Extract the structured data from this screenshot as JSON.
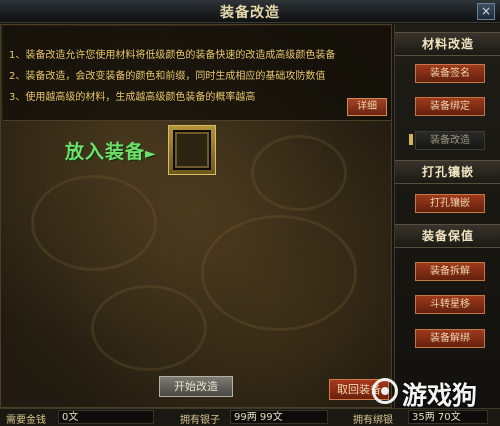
{
  "window": {
    "title": "装备改造",
    "close_glyph": "×"
  },
  "description": {
    "lines": [
      "1、装备改造允许您使用材料将低级颜色的装备快速的改造成高级颜色装备",
      "2、装备改造，会改变装备的颜色和前缀，同时生成相应的基础攻防数值",
      "3、使用越高级的材料，生成越高级颜色装备的概率越高"
    ],
    "detail_button": "详细"
  },
  "slot": {
    "label": "放入装备"
  },
  "actions": {
    "start_label": "开始改造",
    "return_label": "取回装备"
  },
  "sidebar": {
    "sections": [
      {
        "header": "材料改造",
        "buttons": [
          {
            "label": "装备签名",
            "active": false
          },
          {
            "label": "装备绑定",
            "active": false
          },
          {
            "label": "装备改造",
            "active": true
          }
        ]
      },
      {
        "header": "打孔镶嵌",
        "buttons": [
          {
            "label": "打孔镶嵌",
            "active": false
          }
        ]
      },
      {
        "header": "装备保值",
        "buttons": [
          {
            "label": "装备拆解",
            "active": false
          },
          {
            "label": "斗转星移",
            "active": false
          },
          {
            "label": "装备解绑",
            "active": false
          }
        ]
      }
    ]
  },
  "bottom": {
    "cost_label": "需要金钱",
    "cost_value": "0文",
    "silver_label": "拥有银子",
    "silver_value": "99两 99文",
    "bound_label": "拥有绑银",
    "bound_value": "35两 70文"
  },
  "watermark": {
    "text": "游戏狗"
  },
  "colors": {
    "accent_red": "#9e3a1c",
    "description_text": "#e8c66c",
    "slot_label": "#6ee06a",
    "title_text": "#e4d7a9"
  }
}
